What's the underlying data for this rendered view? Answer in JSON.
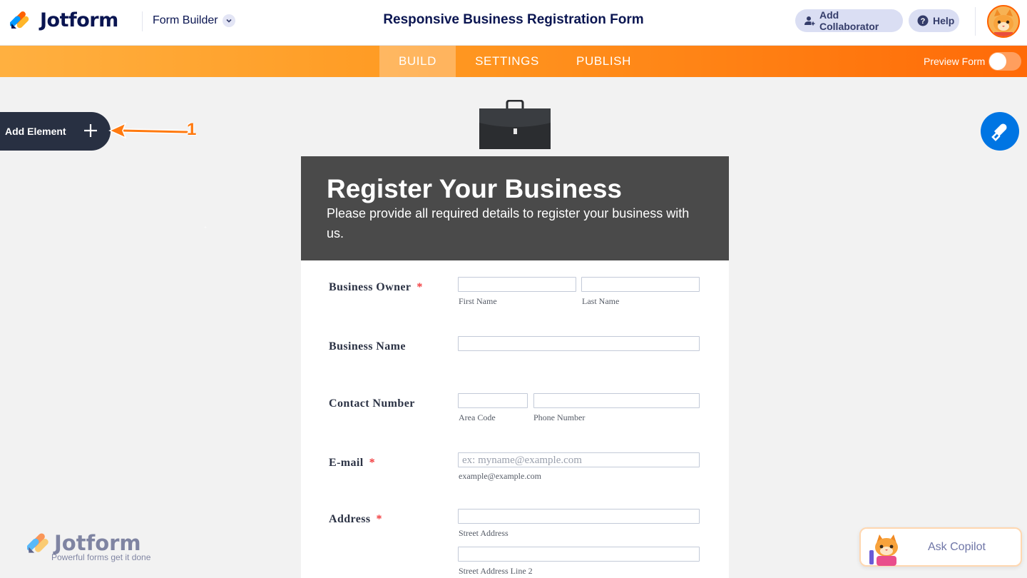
{
  "header": {
    "brand": "Jotform",
    "builder_menu": "Form Builder",
    "form_title": "Responsive Business Registration Form",
    "add_collaborator": "Add Collaborator",
    "help": "Help"
  },
  "nav": {
    "tabs": [
      {
        "label": "BUILD",
        "active": true
      },
      {
        "label": "SETTINGS",
        "active": false
      },
      {
        "label": "PUBLISH",
        "active": false
      }
    ],
    "preview_label": "Preview Form",
    "preview_on": false
  },
  "canvas": {
    "add_element": "Add Element",
    "annotation_number": "1"
  },
  "form": {
    "heading": "Register Your Business",
    "subheading": "Please provide all required details to register your business with us.",
    "fields": {
      "owner": {
        "label": "Business Owner",
        "required": "*",
        "first": "First Name",
        "last": "Last Name"
      },
      "business_name": {
        "label": "Business Name"
      },
      "contact": {
        "label": "Contact Number",
        "area": "Area Code",
        "phone": "Phone Number"
      },
      "email": {
        "label": "E-mail",
        "required": "*",
        "placeholder": "ex: myname@example.com",
        "hint": "example@example.com"
      },
      "address": {
        "label": "Address",
        "required": "*",
        "line1": "Street Address",
        "line2": "Street Address Line 2"
      }
    }
  },
  "watermark": {
    "brand": "Jotform",
    "tagline": "Powerful forms get it done"
  },
  "copilot": {
    "label": "Ask Copilot"
  },
  "colors": {
    "brand_navy": "#0a1551",
    "nav_orange": "#ff7a10",
    "accent_blue": "#0075e3",
    "form_header": "#4a4a4a",
    "required_red": "#f23a3c"
  }
}
